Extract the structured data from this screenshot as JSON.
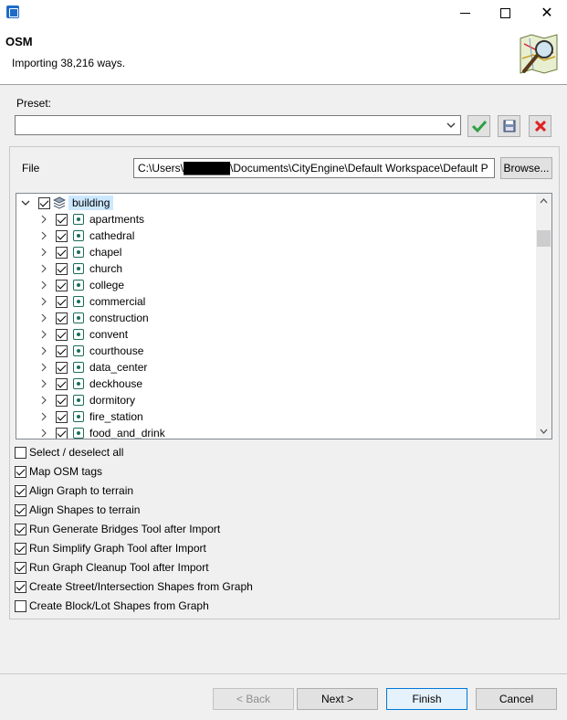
{
  "window": {
    "title": "",
    "minimize_glyph": "",
    "close_glyph": "✕"
  },
  "header": {
    "title": "OSM",
    "description": "Importing 38,216 ways."
  },
  "preset": {
    "label": "Preset:",
    "value": ""
  },
  "file": {
    "label": "File",
    "path": "C:\\Users\\██████\\Documents\\CityEngine\\Default Workspace\\Default P",
    "browse_label": "Browse..."
  },
  "tree": {
    "root": {
      "label": "building",
      "checked": true
    },
    "items": [
      {
        "label": "apartments",
        "checked": true
      },
      {
        "label": "cathedral",
        "checked": true
      },
      {
        "label": "chapel",
        "checked": true
      },
      {
        "label": "church",
        "checked": true
      },
      {
        "label": "college",
        "checked": true
      },
      {
        "label": "commercial",
        "checked": true
      },
      {
        "label": "construction",
        "checked": true
      },
      {
        "label": "convent",
        "checked": true
      },
      {
        "label": "courthouse",
        "checked": true
      },
      {
        "label": "data_center",
        "checked": true
      },
      {
        "label": "deckhouse",
        "checked": true
      },
      {
        "label": "dormitory",
        "checked": true
      },
      {
        "label": "fire_station",
        "checked": true
      },
      {
        "label": "food_and_drink",
        "checked": true
      }
    ]
  },
  "options": [
    {
      "label": "Select / deselect all",
      "checked": false
    },
    {
      "label": "Map OSM tags",
      "checked": true
    },
    {
      "label": "Align Graph to terrain",
      "checked": true
    },
    {
      "label": "Align Shapes to terrain",
      "checked": true
    },
    {
      "label": "Run Generate Bridges Tool after Import",
      "checked": true
    },
    {
      "label": "Run Simplify Graph Tool after Import",
      "checked": true
    },
    {
      "label": "Run Graph Cleanup Tool after Import",
      "checked": true
    },
    {
      "label": "Create Street/Intersection Shapes from Graph",
      "checked": true
    },
    {
      "label": "Create Block/Lot Shapes from Graph",
      "checked": false
    }
  ],
  "buttons": {
    "back": "< Back",
    "next": "Next >",
    "finish": "Finish",
    "cancel": "Cancel"
  },
  "colors": {
    "accent": "#0078d7",
    "selection": "#cce8ff",
    "apply_green": "#2ea043",
    "delete_red": "#e02020",
    "node_icon": "#1a6e5a"
  }
}
